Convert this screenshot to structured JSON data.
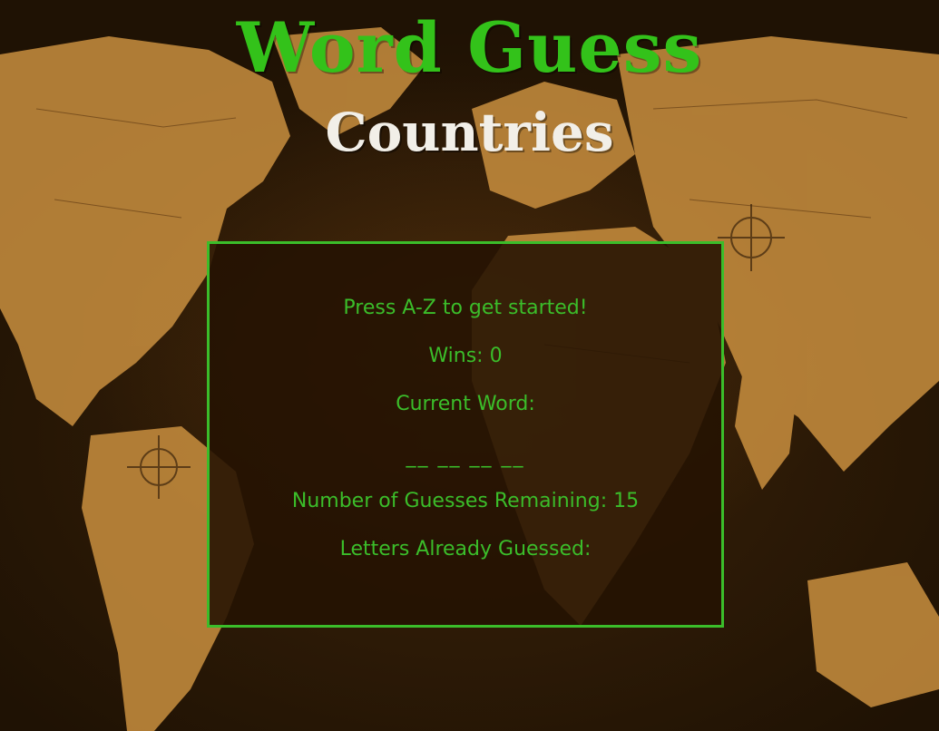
{
  "header": {
    "title": "Word Guess",
    "subtitle": "Countries"
  },
  "game": {
    "prompt": "Press A-Z to get started!",
    "wins_label": "Wins: 0",
    "current_word_label": "Current Word:",
    "current_word_blanks": "__ __ __ __",
    "guesses_remaining_label": "Number of Guesses Remaining: 15",
    "letters_guessed_label": "Letters Already Guessed:"
  },
  "colors": {
    "accent": "#33c21a",
    "panel_border": "#3bbd2a",
    "subtitle": "#f2efe8"
  }
}
